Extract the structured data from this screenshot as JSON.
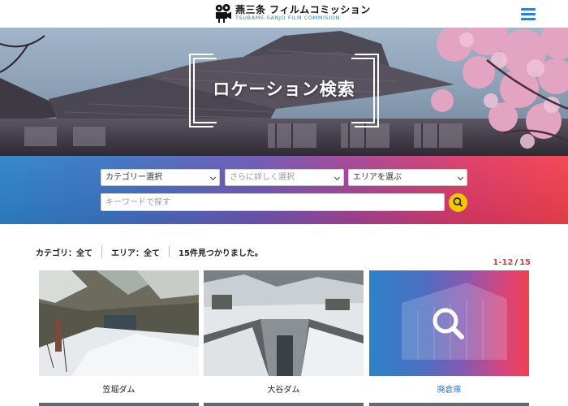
{
  "header": {
    "logo_main": "燕三条 フィルムコミッション",
    "logo_sub": "TSUBAME-SANJO FILM COMMISION"
  },
  "hero": {
    "title": "ロケーション検索"
  },
  "search": {
    "category_select": "カテゴリー選択",
    "detail_select": "さらに詳しく選択",
    "area_select": "エリアを選ぶ",
    "keyword_placeholder": "キーワードで探す"
  },
  "summary": {
    "category": "カテゴリ：全て",
    "area": "エリア：全て",
    "result": "15件見つかりました。"
  },
  "pager": {
    "range": "1-12",
    "total": "15"
  },
  "cards": [
    {
      "name": "笠堀ダム",
      "placeholder": false
    },
    {
      "name": "大谷ダム",
      "placeholder": false
    },
    {
      "name": "廃倉庫",
      "placeholder": true
    }
  ],
  "colors": {
    "accent": "#2f7fd6",
    "pager_red": "#e23b3b",
    "search_button": "#f6c700"
  }
}
